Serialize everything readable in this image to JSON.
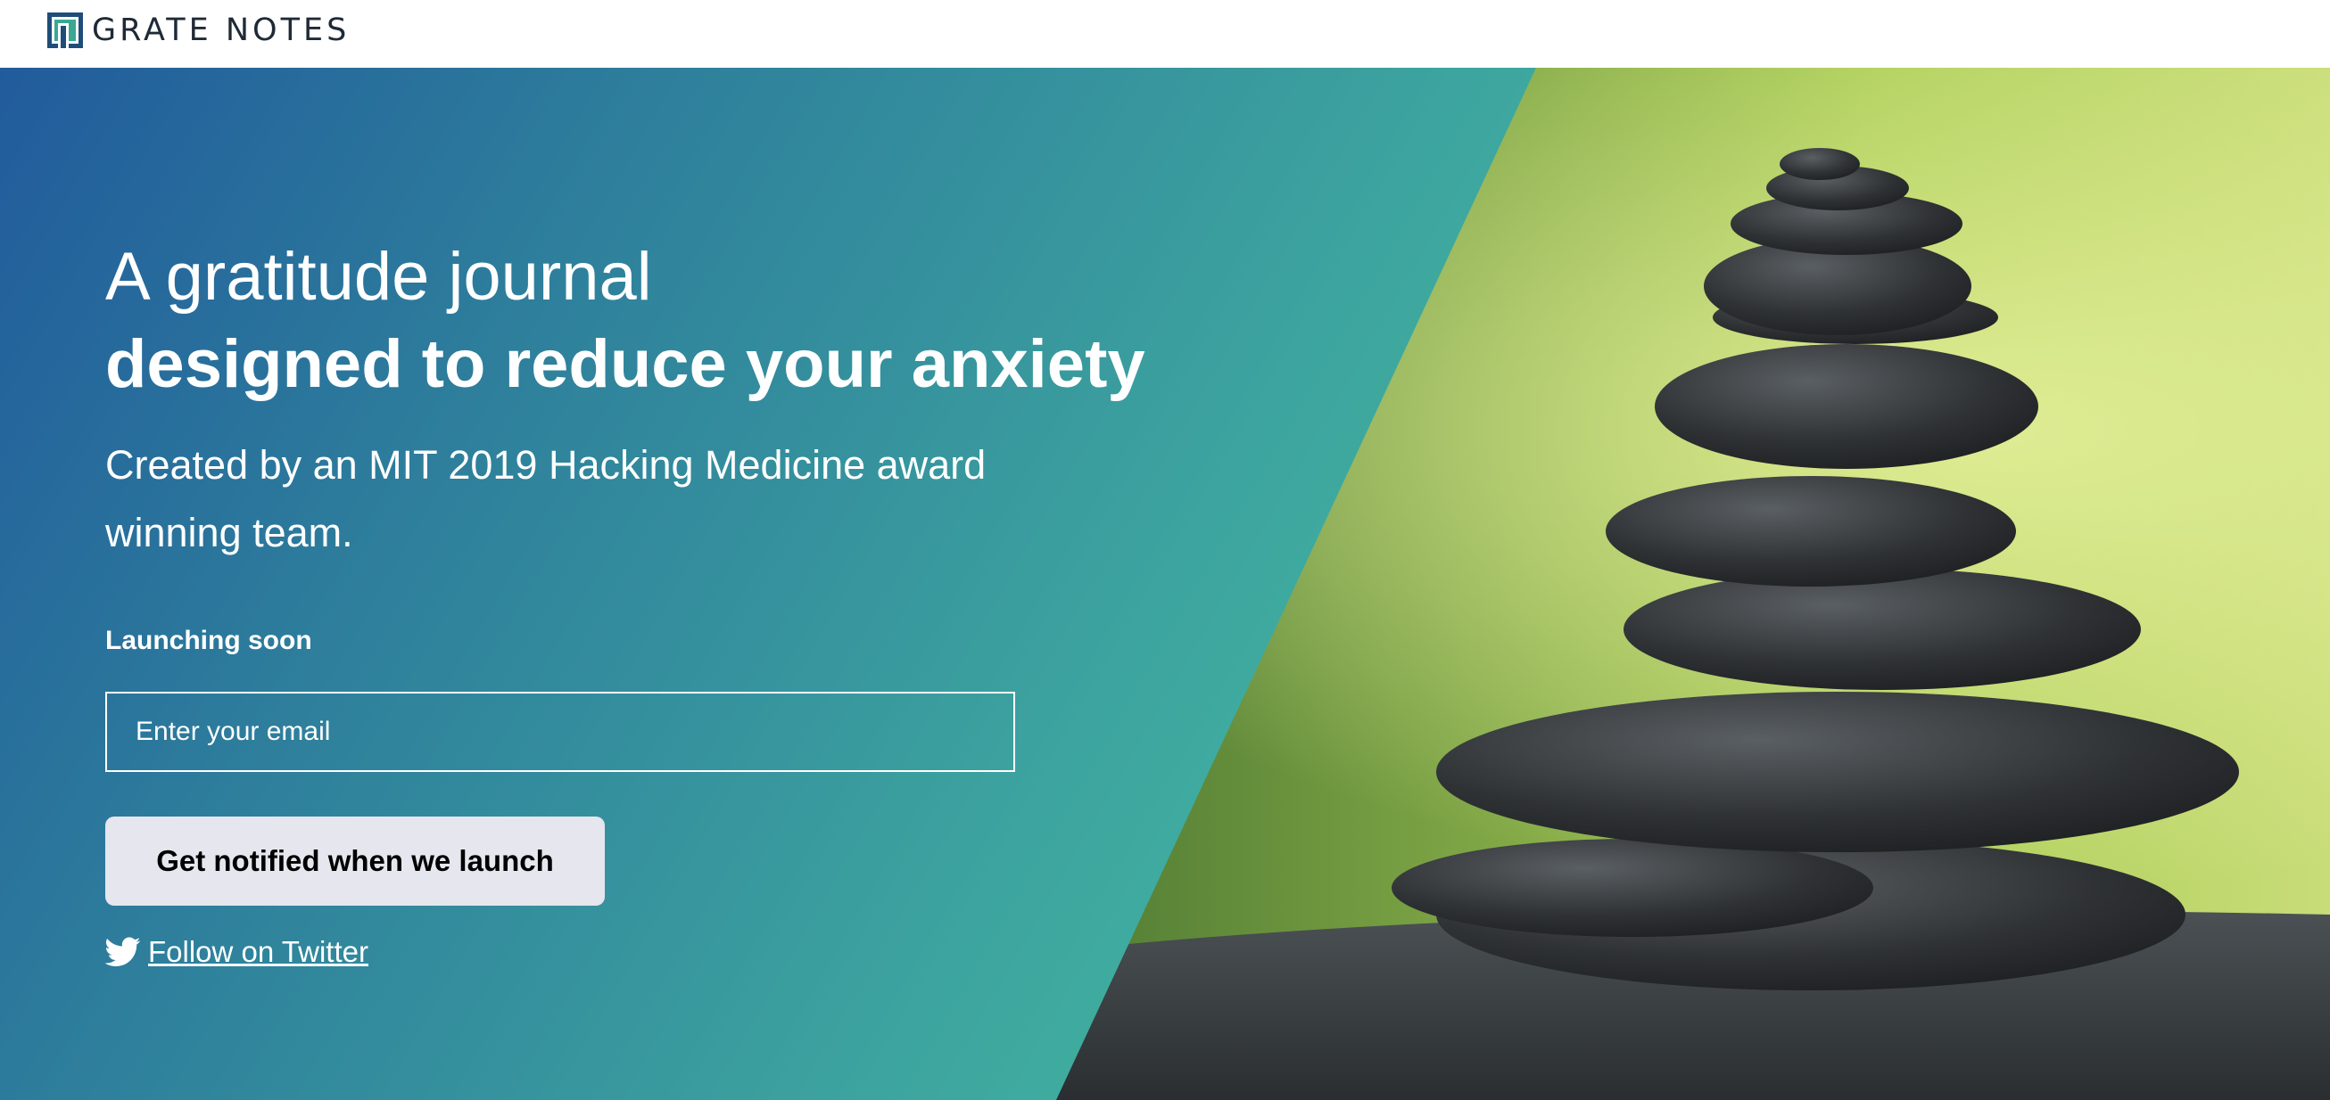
{
  "brand": {
    "name": "GRATE NOTES",
    "logo_icon": "grate-notes-logo-icon"
  },
  "hero": {
    "headline_line1": "A gratitude journal",
    "headline_line2": "designed to reduce your anxiety",
    "subtitle": "Created by an MIT 2019 Hacking Medicine award winning team.",
    "launch_label": "Launching soon",
    "email_placeholder": "Enter your email",
    "email_value": "",
    "notify_button_label": "Get notified when we launch",
    "twitter_link_label": "Follow on Twitter",
    "twitter_icon": "twitter-icon",
    "background_image": "stacked-stones-photo"
  },
  "colors": {
    "gradient_start": "#215b9c",
    "gradient_end": "#4ad3a0",
    "button_bg": "#e6e6ee",
    "logo_dark": "#1f2a36",
    "logo_teal": "#3aa893"
  }
}
